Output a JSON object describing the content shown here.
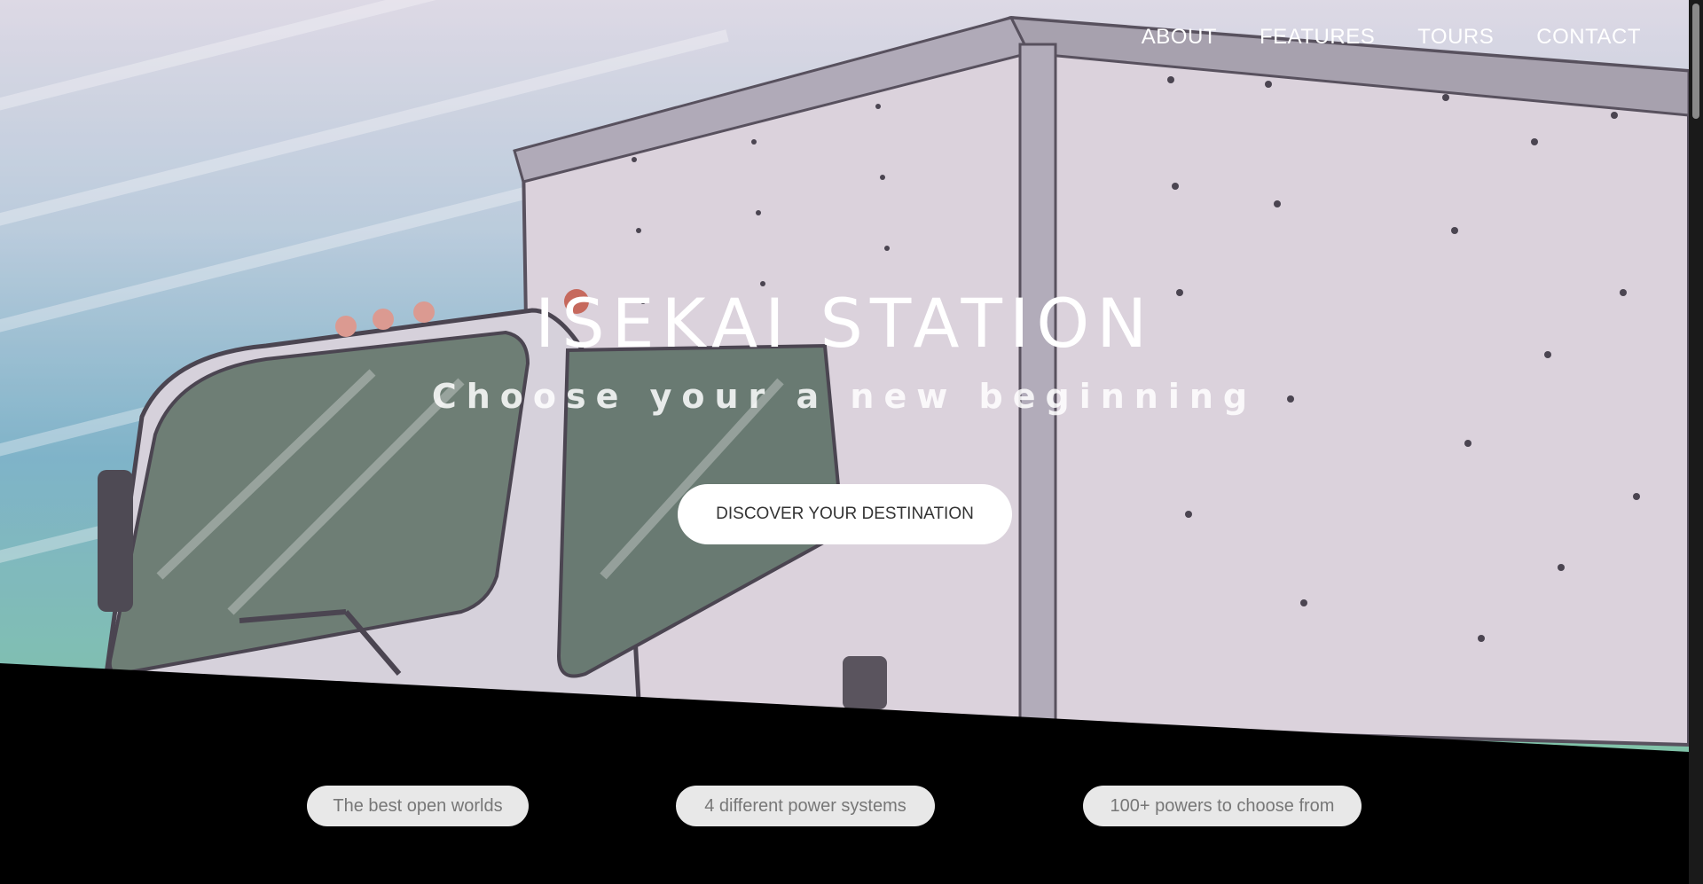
{
  "nav": {
    "items": [
      {
        "label": "ABOUT"
      },
      {
        "label": "FEATURES"
      },
      {
        "label": "TOURS"
      },
      {
        "label": "CONTACT"
      }
    ]
  },
  "hero": {
    "title": "ISEKAI STATION",
    "subtitle": "Choose your a new beginning",
    "cta_label": "DISCOVER YOUR DESTINATION",
    "image_subject": "truck-illustration"
  },
  "features": [
    {
      "label": "The best open worlds"
    },
    {
      "label": "4 different power systems"
    },
    {
      "label": "100+ powers to choose from"
    }
  ],
  "colors": {
    "page_background": "#000000",
    "pill_background": "#e8e8e8",
    "pill_text": "#777777",
    "nav_text": "#ffffff"
  }
}
